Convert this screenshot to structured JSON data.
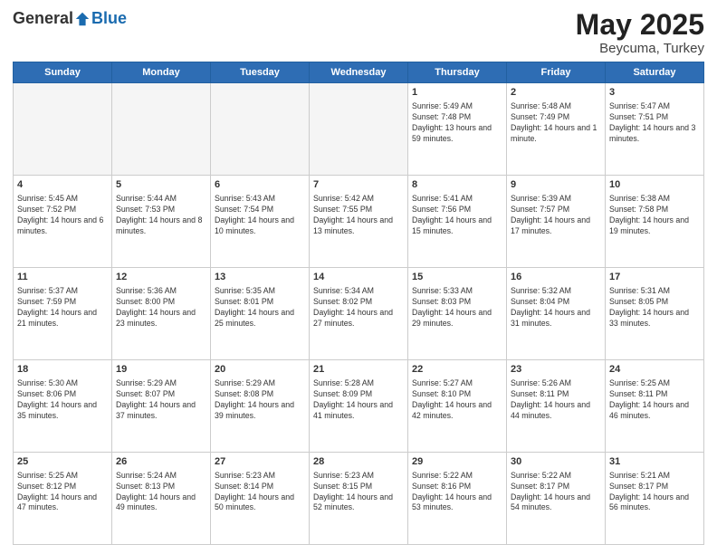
{
  "logo": {
    "general": "General",
    "blue": "Blue"
  },
  "title": {
    "month": "May 2025",
    "location": "Beycuma, Turkey"
  },
  "weekdays": [
    "Sunday",
    "Monday",
    "Tuesday",
    "Wednesday",
    "Thursday",
    "Friday",
    "Saturday"
  ],
  "weeks": [
    [
      {
        "day": "",
        "info": ""
      },
      {
        "day": "",
        "info": ""
      },
      {
        "day": "",
        "info": ""
      },
      {
        "day": "",
        "info": ""
      },
      {
        "day": "1",
        "info": "Sunrise: 5:49 AM\nSunset: 7:48 PM\nDaylight: 13 hours and 59 minutes."
      },
      {
        "day": "2",
        "info": "Sunrise: 5:48 AM\nSunset: 7:49 PM\nDaylight: 14 hours and 1 minute."
      },
      {
        "day": "3",
        "info": "Sunrise: 5:47 AM\nSunset: 7:51 PM\nDaylight: 14 hours and 3 minutes."
      }
    ],
    [
      {
        "day": "4",
        "info": "Sunrise: 5:45 AM\nSunset: 7:52 PM\nDaylight: 14 hours and 6 minutes."
      },
      {
        "day": "5",
        "info": "Sunrise: 5:44 AM\nSunset: 7:53 PM\nDaylight: 14 hours and 8 minutes."
      },
      {
        "day": "6",
        "info": "Sunrise: 5:43 AM\nSunset: 7:54 PM\nDaylight: 14 hours and 10 minutes."
      },
      {
        "day": "7",
        "info": "Sunrise: 5:42 AM\nSunset: 7:55 PM\nDaylight: 14 hours and 13 minutes."
      },
      {
        "day": "8",
        "info": "Sunrise: 5:41 AM\nSunset: 7:56 PM\nDaylight: 14 hours and 15 minutes."
      },
      {
        "day": "9",
        "info": "Sunrise: 5:39 AM\nSunset: 7:57 PM\nDaylight: 14 hours and 17 minutes."
      },
      {
        "day": "10",
        "info": "Sunrise: 5:38 AM\nSunset: 7:58 PM\nDaylight: 14 hours and 19 minutes."
      }
    ],
    [
      {
        "day": "11",
        "info": "Sunrise: 5:37 AM\nSunset: 7:59 PM\nDaylight: 14 hours and 21 minutes."
      },
      {
        "day": "12",
        "info": "Sunrise: 5:36 AM\nSunset: 8:00 PM\nDaylight: 14 hours and 23 minutes."
      },
      {
        "day": "13",
        "info": "Sunrise: 5:35 AM\nSunset: 8:01 PM\nDaylight: 14 hours and 25 minutes."
      },
      {
        "day": "14",
        "info": "Sunrise: 5:34 AM\nSunset: 8:02 PM\nDaylight: 14 hours and 27 minutes."
      },
      {
        "day": "15",
        "info": "Sunrise: 5:33 AM\nSunset: 8:03 PM\nDaylight: 14 hours and 29 minutes."
      },
      {
        "day": "16",
        "info": "Sunrise: 5:32 AM\nSunset: 8:04 PM\nDaylight: 14 hours and 31 minutes."
      },
      {
        "day": "17",
        "info": "Sunrise: 5:31 AM\nSunset: 8:05 PM\nDaylight: 14 hours and 33 minutes."
      }
    ],
    [
      {
        "day": "18",
        "info": "Sunrise: 5:30 AM\nSunset: 8:06 PM\nDaylight: 14 hours and 35 minutes."
      },
      {
        "day": "19",
        "info": "Sunrise: 5:29 AM\nSunset: 8:07 PM\nDaylight: 14 hours and 37 minutes."
      },
      {
        "day": "20",
        "info": "Sunrise: 5:29 AM\nSunset: 8:08 PM\nDaylight: 14 hours and 39 minutes."
      },
      {
        "day": "21",
        "info": "Sunrise: 5:28 AM\nSunset: 8:09 PM\nDaylight: 14 hours and 41 minutes."
      },
      {
        "day": "22",
        "info": "Sunrise: 5:27 AM\nSunset: 8:10 PM\nDaylight: 14 hours and 42 minutes."
      },
      {
        "day": "23",
        "info": "Sunrise: 5:26 AM\nSunset: 8:11 PM\nDaylight: 14 hours and 44 minutes."
      },
      {
        "day": "24",
        "info": "Sunrise: 5:25 AM\nSunset: 8:11 PM\nDaylight: 14 hours and 46 minutes."
      }
    ],
    [
      {
        "day": "25",
        "info": "Sunrise: 5:25 AM\nSunset: 8:12 PM\nDaylight: 14 hours and 47 minutes."
      },
      {
        "day": "26",
        "info": "Sunrise: 5:24 AM\nSunset: 8:13 PM\nDaylight: 14 hours and 49 minutes."
      },
      {
        "day": "27",
        "info": "Sunrise: 5:23 AM\nSunset: 8:14 PM\nDaylight: 14 hours and 50 minutes."
      },
      {
        "day": "28",
        "info": "Sunrise: 5:23 AM\nSunset: 8:15 PM\nDaylight: 14 hours and 52 minutes."
      },
      {
        "day": "29",
        "info": "Sunrise: 5:22 AM\nSunset: 8:16 PM\nDaylight: 14 hours and 53 minutes."
      },
      {
        "day": "30",
        "info": "Sunrise: 5:22 AM\nSunset: 8:17 PM\nDaylight: 14 hours and 54 minutes."
      },
      {
        "day": "31",
        "info": "Sunrise: 5:21 AM\nSunset: 8:17 PM\nDaylight: 14 hours and 56 minutes."
      }
    ]
  ]
}
